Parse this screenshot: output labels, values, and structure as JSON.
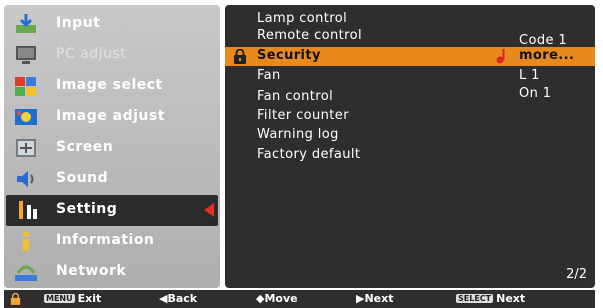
{
  "menu": {
    "items": [
      {
        "label": "Input",
        "icon": "input-icon"
      },
      {
        "label": "PC adjust",
        "icon": "pc-adjust-icon"
      },
      {
        "label": "Image select",
        "icon": "image-select-icon"
      },
      {
        "label": "Image adjust",
        "icon": "image-adjust-icon"
      },
      {
        "label": "Screen",
        "icon": "screen-icon"
      },
      {
        "label": "Sound",
        "icon": "sound-icon"
      },
      {
        "label": "Setting",
        "icon": "setting-icon"
      },
      {
        "label": "Information",
        "icon": "information-icon"
      },
      {
        "label": "Network",
        "icon": "network-icon"
      }
    ],
    "selected": "Setting"
  },
  "settings": {
    "rows": [
      {
        "label": "Lamp control",
        "value": ""
      },
      {
        "label": "Remote control",
        "value": "Code 1"
      },
      {
        "label": "Security",
        "value": "more..."
      },
      {
        "label": "Fan",
        "value": "L 1"
      },
      {
        "label": "Fan control",
        "value": "On 1"
      },
      {
        "label": "Filter counter",
        "value": ""
      },
      {
        "label": "Warning log",
        "value": ""
      },
      {
        "label": "Factory default",
        "value": ""
      }
    ],
    "highlighted": "Security",
    "page": "2/2"
  },
  "bottom_bar": {
    "exit_key": "MENU",
    "exit_label": "Exit",
    "back_label": "◀Back",
    "move_label": "◆Move",
    "next_label": "▶Next",
    "select_key": "SELECT",
    "select_next_label": "Next"
  },
  "colors": {
    "highlight": "#e8891e",
    "panel": "#2e2e2e",
    "menu": "#bdbdbd",
    "pointer": "#e03020"
  }
}
